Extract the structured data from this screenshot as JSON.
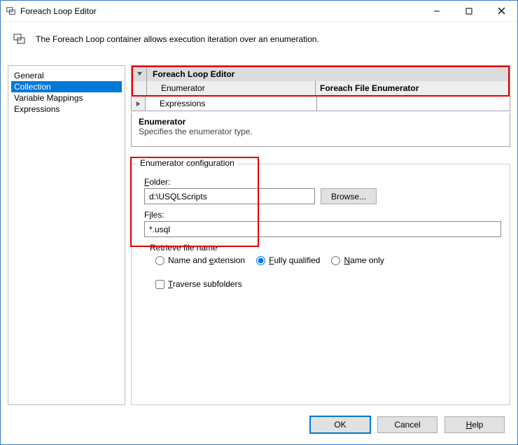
{
  "window": {
    "title": "Foreach Loop Editor",
    "description": "The Foreach Loop container allows execution iteration over an enumeration."
  },
  "nav": {
    "items": [
      {
        "label": "General",
        "selected": false
      },
      {
        "label": "Collection",
        "selected": true
      },
      {
        "label": "Variable Mappings",
        "selected": false
      },
      {
        "label": "Expressions",
        "selected": false
      }
    ]
  },
  "grid": {
    "section": "Foreach Loop Editor",
    "rows": [
      {
        "label": "Enumerator",
        "value": "Foreach File Enumerator"
      },
      {
        "label": "Expressions",
        "value": ""
      }
    ]
  },
  "descBox": {
    "heading": "Enumerator",
    "text": "Specifies the enumerator type."
  },
  "config": {
    "legend": "Enumerator configuration",
    "folderLabel": "Folder:",
    "folderValue": "d:\\USQLScripts",
    "browse": "Browse...",
    "filesLabel": "Files:",
    "filesValue": "*.usql",
    "retrieveLabel": "Retrieve file name",
    "radios": {
      "nameExt": "Name and extension",
      "fully": "Fully qualified",
      "nameOnly": "Name only",
      "selected": "fully"
    },
    "traverse": "Traverse subfolders"
  },
  "footer": {
    "ok": "OK",
    "cancel": "Cancel",
    "help": "Help"
  }
}
